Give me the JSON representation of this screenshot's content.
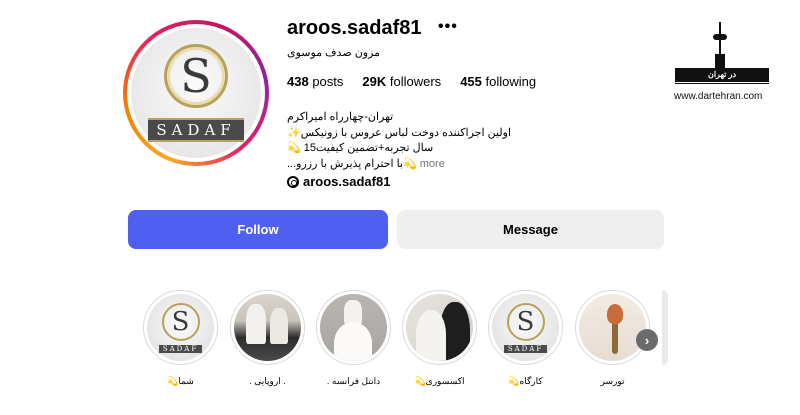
{
  "profile": {
    "username": "aroos.sadaf81",
    "more_icon": "•••",
    "full_name": "مزون صدف موسوی",
    "avatar_logo": {
      "letter": "S",
      "word": "SADAF"
    },
    "stats": {
      "posts_count": "438",
      "posts_label": "posts",
      "followers_count": "29K",
      "followers_label": "followers",
      "following_count": "455",
      "following_label": "following"
    },
    "bio": {
      "line1": "تهران-چهارراه امیراکرم",
      "line2": "✨اولین اجراکننده دوخت لباس عروس با زونیکس",
      "line3": "💫 15سال تجربه+تضمین کیفیت",
      "line4": "...با احترام پذیرش با رزرو💫",
      "more": "more"
    },
    "threads_handle": "aroos.sadaf81"
  },
  "actions": {
    "follow_label": "Follow",
    "message_label": "Message"
  },
  "watermark": {
    "bar_text": "در تهران",
    "url": "www.dartehran.com"
  },
  "highlights": [
    {
      "label": "شما💫"
    },
    {
      "label": ". اروپایی ."
    },
    {
      "label": "دانتل فرانسه ."
    },
    {
      "label": "اکسسوری💫"
    },
    {
      "label": "کارگاه💫"
    },
    {
      "label": "تورسر"
    }
  ],
  "highlight_logo": {
    "letter": "S",
    "word": "SADAF"
  },
  "next_icon": "›",
  "colors": {
    "follow_bg": "#4f5ff0",
    "message_bg": "#efefef",
    "muted_text": "#737373"
  }
}
